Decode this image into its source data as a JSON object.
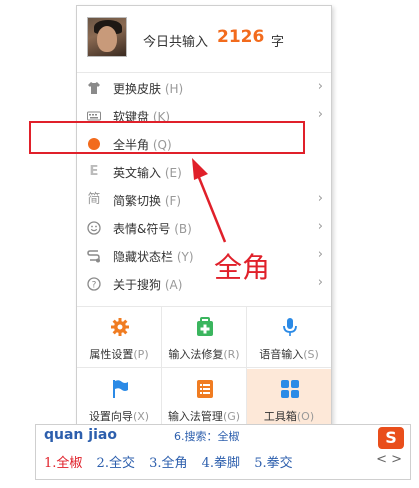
{
  "header": {
    "count_label": "今日共输入",
    "count_value": "2126",
    "count_unit": "字"
  },
  "menu_items": [
    {
      "label": "更换皮肤",
      "shortcut": "(H)",
      "icon": "shirt-icon",
      "has_submenu": true
    },
    {
      "label": "软键盘",
      "shortcut": "(K)",
      "icon": "keyboard-icon",
      "has_submenu": true
    },
    {
      "label": "全半角",
      "shortcut": "(Q)",
      "icon": "circle-icon",
      "has_submenu": false
    },
    {
      "label": "英文输入",
      "shortcut": "(E)",
      "icon": "letter-e-icon",
      "has_submenu": false
    },
    {
      "label": "简繁切换",
      "shortcut": "(F)",
      "icon": "jian-char-icon",
      "has_submenu": true
    },
    {
      "label": "表情&符号",
      "shortcut": "(B)",
      "icon": "smiley-icon",
      "has_submenu": true
    },
    {
      "label": "隐藏状态栏",
      "shortcut": "(Y)",
      "icon": "hide-statusbar-icon",
      "has_submenu": true
    },
    {
      "label": "关于搜狗",
      "shortcut": "(A)",
      "icon": "question-icon",
      "has_submenu": true
    }
  ],
  "tools": [
    {
      "label": "属性设置",
      "shortcut": "(P)",
      "icon": "gear-icon"
    },
    {
      "label": "输入法修复",
      "shortcut": "(R)",
      "icon": "repair-kit-icon"
    },
    {
      "label": "语音输入",
      "shortcut": "(S)",
      "icon": "microphone-icon"
    },
    {
      "label": "设置向导",
      "shortcut": "(X)",
      "icon": "flag-icon"
    },
    {
      "label": "输入法管理",
      "shortcut": "(G)",
      "icon": "list-icon"
    },
    {
      "label": "工具箱",
      "shortcut": "(O)",
      "icon": "grid-icon"
    }
  ],
  "annotation": "全角",
  "candidate_bar": {
    "pinyin": "quan jiao",
    "search_hint": "6.搜索：全椒",
    "candidates": [
      "1.全椒",
      "2.全交",
      "3.全角",
      "4.拳脚",
      "5.拳交"
    ],
    "nav": "< >"
  },
  "colors": {
    "accent": "#f26b1d",
    "annotation_red": "#e0202a",
    "candidate_blue": "#2d5fad",
    "tool_orange": "#f07c21",
    "tool_green": "#3bb55e",
    "tool_blue": "#2b8ae6"
  }
}
